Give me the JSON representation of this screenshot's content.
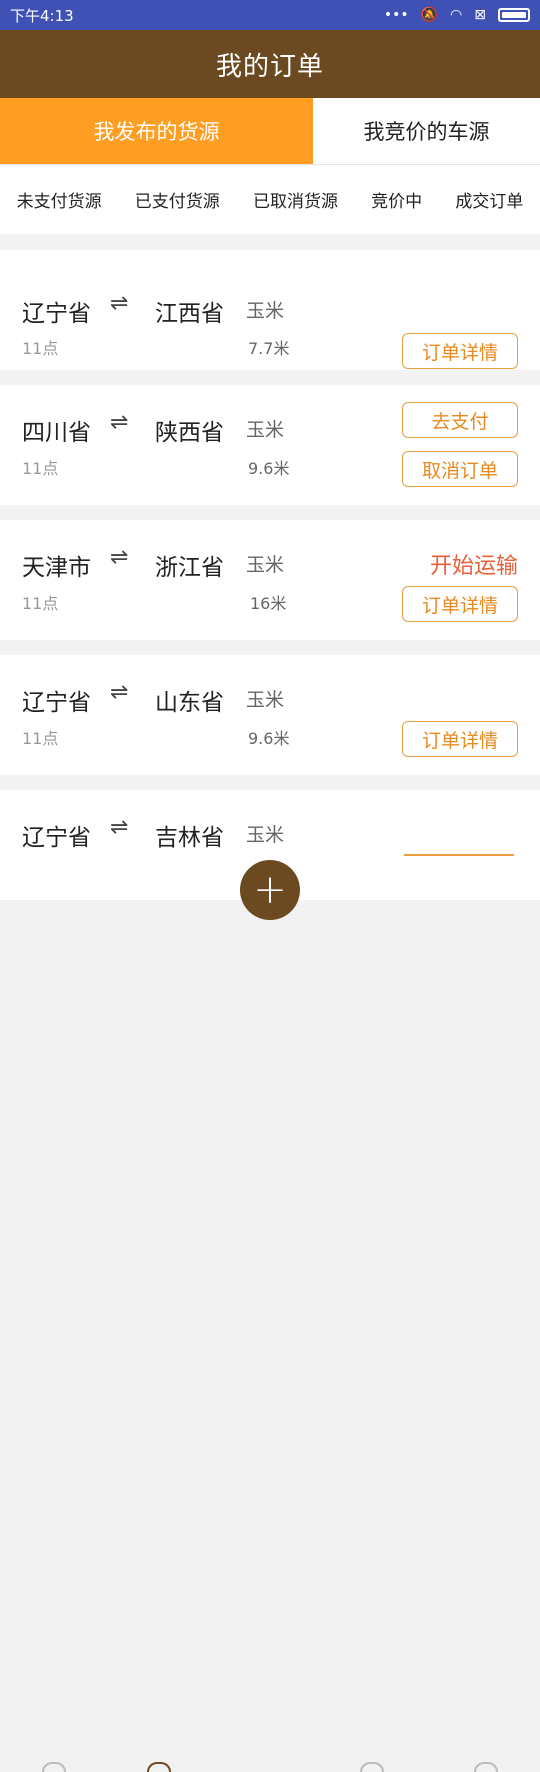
{
  "status_bar": {
    "time": "下午4:13"
  },
  "header": {
    "title": "我的订单"
  },
  "tabs": [
    {
      "label": "我发布的货源",
      "active": true
    },
    {
      "label": "我竞价的车源",
      "active": false
    }
  ],
  "subtabs": [
    "未支付货源",
    "已支付货源",
    "已取消货源",
    "竞价中",
    "成交订单"
  ],
  "orders": [
    {
      "from": "辽宁省",
      "to": "江西省",
      "cargo": "玉米",
      "time": "11点",
      "length": "7.7米",
      "status": "",
      "buttons": [
        "订单详情"
      ]
    },
    {
      "from": "四川省",
      "to": "陕西省",
      "cargo": "玉米",
      "time": "11点",
      "length": "9.6米",
      "status": "",
      "buttons": [
        "去支付",
        "取消订单"
      ]
    },
    {
      "from": "天津市",
      "to": "浙江省",
      "cargo": "玉米",
      "time": "11点",
      "length": "16米",
      "status": "开始运输",
      "buttons": [
        "订单详情"
      ]
    },
    {
      "from": "辽宁省",
      "to": "山东省",
      "cargo": "玉米",
      "time": "11点",
      "length": "9.6米",
      "status": "",
      "buttons": [
        "订单详情"
      ]
    },
    {
      "from": "辽宁省",
      "to": "吉林省",
      "cargo": "玉米",
      "time": "",
      "length": "",
      "status": "",
      "buttons": []
    }
  ],
  "fab": {
    "label": "+"
  },
  "colors": {
    "status_bar": "#3f51b5",
    "header": "#6b4a22",
    "tab_active": "#ff9e23",
    "button_border": "#e9a040",
    "status_text": "#e8603a"
  }
}
